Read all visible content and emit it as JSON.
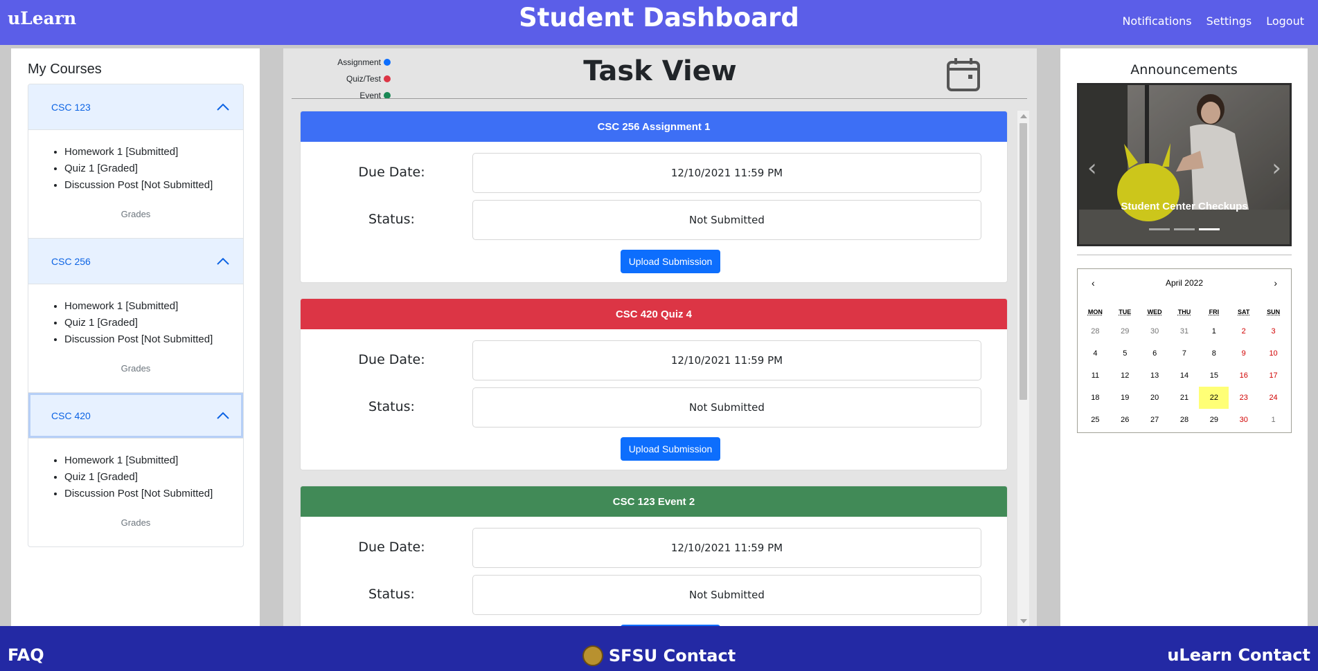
{
  "header": {
    "logo": "uLearn",
    "title": "Student Dashboard",
    "nav": [
      "Notifications",
      "Settings",
      "Logout"
    ]
  },
  "courses": {
    "title": "My Courses",
    "items": [
      {
        "name": "CSC 123",
        "tasks": [
          "Homework 1 [Submitted]",
          "Quiz 1 [Graded]",
          "Discussion Post [Not Submitted]"
        ],
        "grades_label": "Grades"
      },
      {
        "name": "CSC 256",
        "tasks": [
          "Homework 1 [Submitted]",
          "Quiz 1 [Graded]",
          "Discussion Post [Not Submitted]"
        ],
        "grades_label": "Grades"
      },
      {
        "name": "CSC 420",
        "tasks": [
          "Homework 1 [Submitted]",
          "Quiz 1 [Graded]",
          "Discussion Post [Not Submitted]"
        ],
        "grades_label": "Grades"
      }
    ]
  },
  "taskview": {
    "title": "Task View",
    "legend": [
      {
        "label": "Assignment",
        "color": "#0d6efd"
      },
      {
        "label": "Quiz/Test",
        "color": "#dc3545"
      },
      {
        "label": "Event",
        "color": "#198754"
      }
    ],
    "calendar_icon": "calendar-icon",
    "due_label": "Due Date:",
    "status_label": "Status:",
    "upload_label": "Upload Submission",
    "tasks": [
      {
        "title": "CSC 256 Assignment 1",
        "due": "12/10/2021 11:59 PM",
        "status": "Not Submitted",
        "color": "#3d6ff5"
      },
      {
        "title": "CSC 420 Quiz 4",
        "due": "12/10/2021 11:59 PM",
        "status": "Not Submitted",
        "color": "#dc3545"
      },
      {
        "title": "CSC 123 Event 2",
        "due": "12/10/2021 11:59 PM",
        "status": "Not Submitted",
        "color": "#418a57"
      }
    ]
  },
  "announcements": {
    "title": "Announcements",
    "caption": "Student Center Checkups",
    "slide_count": 3,
    "active_slide": 3,
    "prev_icon": "chevron-left-icon",
    "next_icon": "chevron-right-icon"
  },
  "calendar": {
    "month_label": "April 2022",
    "prev": "‹",
    "next": "›",
    "weekdays": [
      "MON",
      "TUE",
      "WED",
      "THU",
      "FRI",
      "SAT",
      "SUN"
    ],
    "days": [
      {
        "d": "28",
        "t": "other"
      },
      {
        "d": "29",
        "t": "other"
      },
      {
        "d": "30",
        "t": "other"
      },
      {
        "d": "31",
        "t": "other"
      },
      {
        "d": "1",
        "t": ""
      },
      {
        "d": "2",
        "t": "weekend"
      },
      {
        "d": "3",
        "t": "weekend"
      },
      {
        "d": "4",
        "t": ""
      },
      {
        "d": "5",
        "t": ""
      },
      {
        "d": "6",
        "t": ""
      },
      {
        "d": "7",
        "t": ""
      },
      {
        "d": "8",
        "t": ""
      },
      {
        "d": "9",
        "t": "weekend"
      },
      {
        "d": "10",
        "t": "weekend"
      },
      {
        "d": "11",
        "t": ""
      },
      {
        "d": "12",
        "t": ""
      },
      {
        "d": "13",
        "t": ""
      },
      {
        "d": "14",
        "t": ""
      },
      {
        "d": "15",
        "t": ""
      },
      {
        "d": "16",
        "t": "weekend"
      },
      {
        "d": "17",
        "t": "weekend"
      },
      {
        "d": "18",
        "t": ""
      },
      {
        "d": "19",
        "t": ""
      },
      {
        "d": "20",
        "t": ""
      },
      {
        "d": "21",
        "t": ""
      },
      {
        "d": "22",
        "t": "today"
      },
      {
        "d": "23",
        "t": "weekend"
      },
      {
        "d": "24",
        "t": "weekend"
      },
      {
        "d": "25",
        "t": ""
      },
      {
        "d": "26",
        "t": ""
      },
      {
        "d": "27",
        "t": ""
      },
      {
        "d": "28",
        "t": ""
      },
      {
        "d": "29",
        "t": ""
      },
      {
        "d": "30",
        "t": "weekend"
      },
      {
        "d": "1",
        "t": "other"
      }
    ]
  },
  "footer": {
    "faq": "FAQ",
    "sfsu": "SFSU Contact",
    "ulearn": "uLearn Contact"
  }
}
